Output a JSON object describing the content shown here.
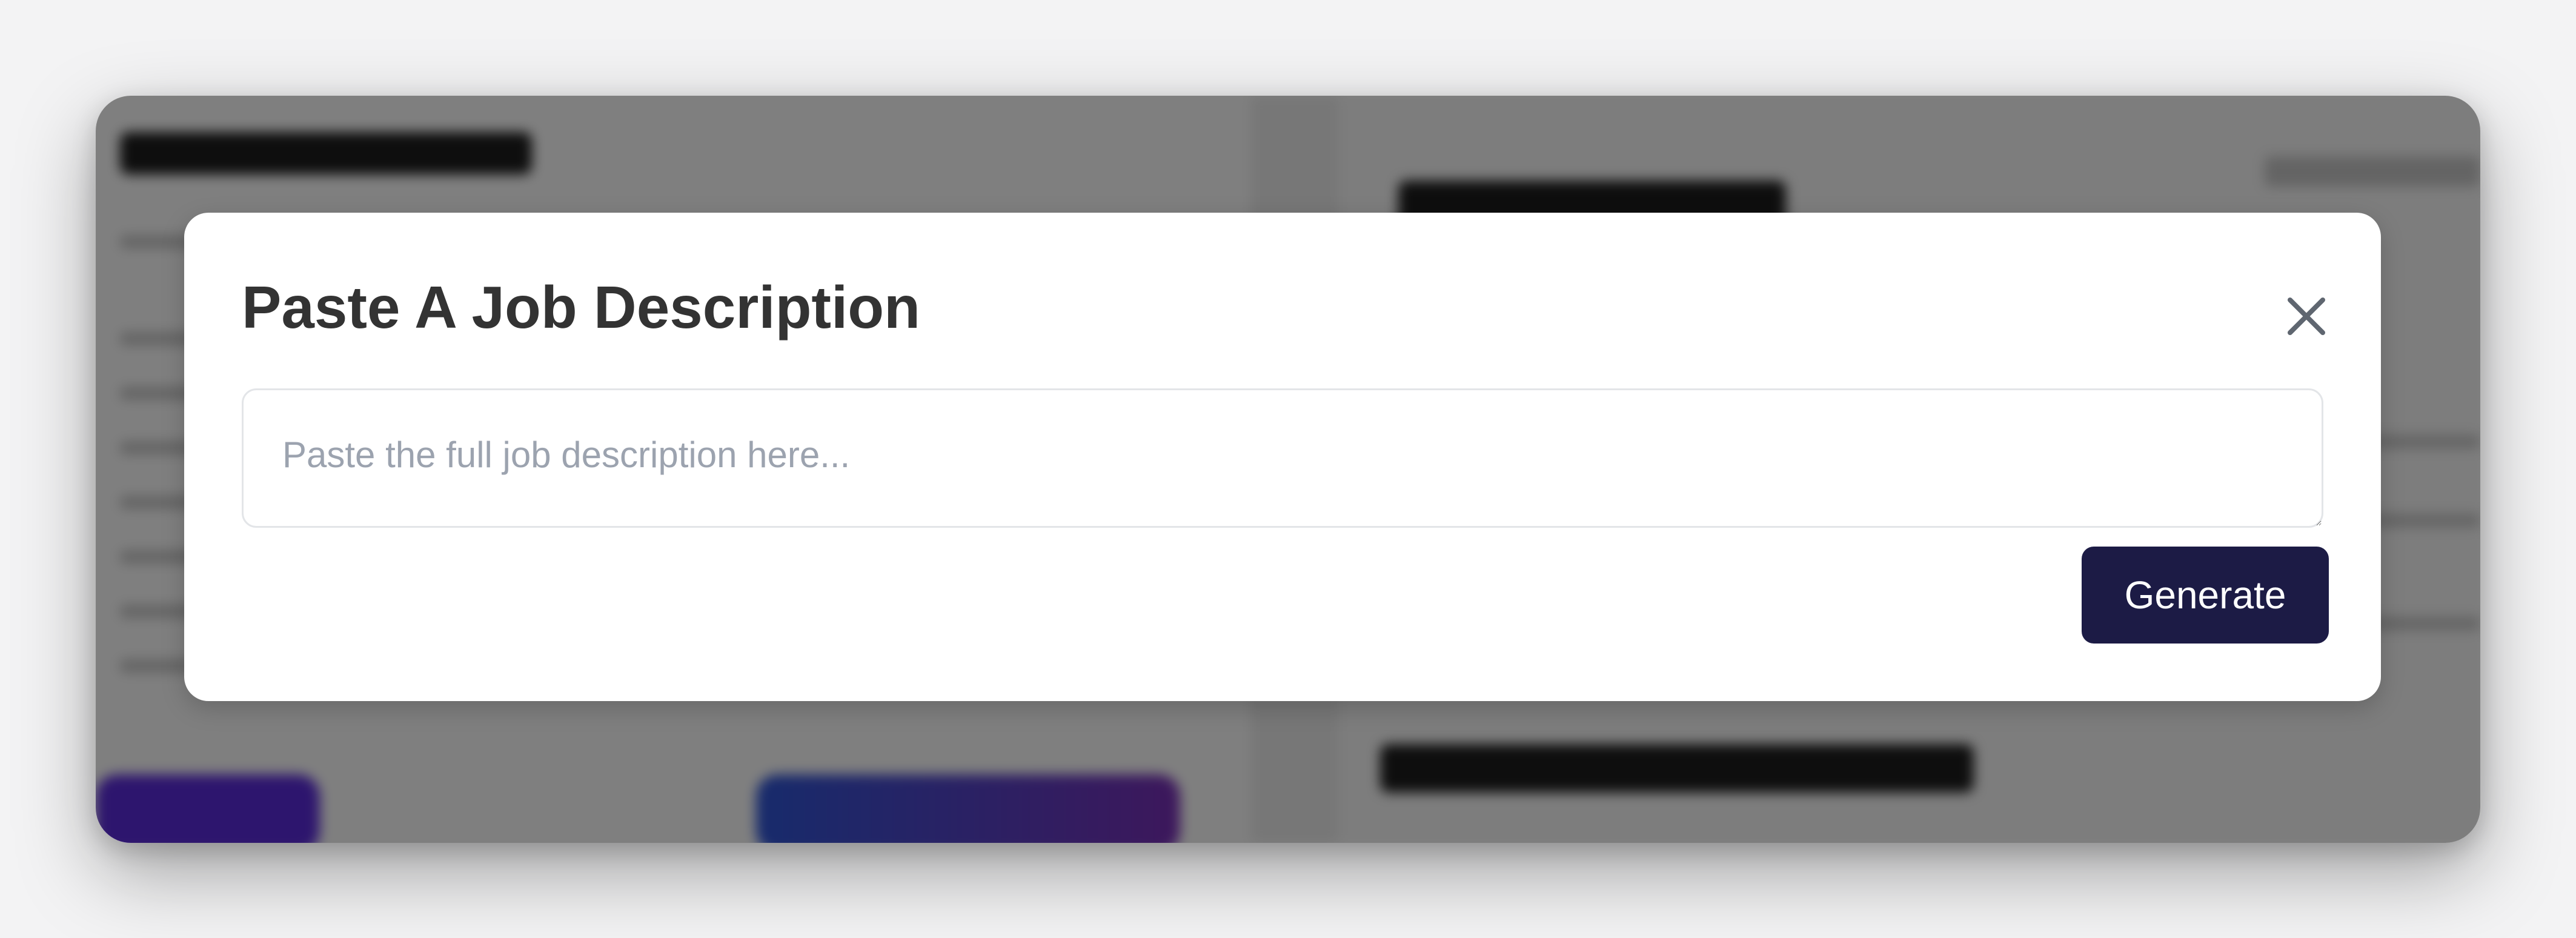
{
  "modal": {
    "title": "Paste A Job Description",
    "input_value": "",
    "input_placeholder": "Paste the full job description here...",
    "generate_label": "Generate",
    "close_icon": "close-icon"
  },
  "colors": {
    "overlay": "#808080",
    "primary_button": "#1c1b45",
    "title_text": "#333333",
    "placeholder_text": "#9ca3af",
    "input_border": "#e3e5e8",
    "accent_gradient_start": "#5b2bdc",
    "accent_gradient_end": "#7a2fb8"
  }
}
